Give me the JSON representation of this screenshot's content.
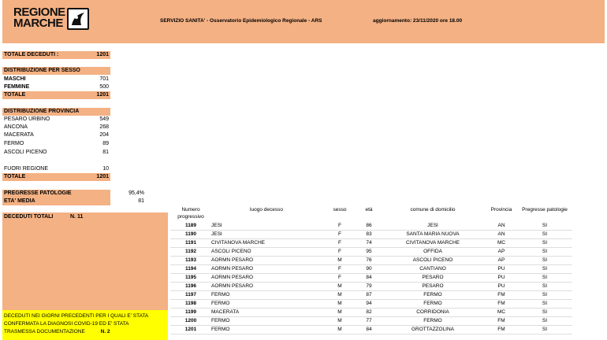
{
  "header": {
    "logo_line1": "REGIONE",
    "logo_line2": "MARCHE",
    "service": "SERVIZIO SANITA' - Osservatorio Epidemiologico Regionale - ARS",
    "update": "aggiornamento: 23/11/2020 ore 18.00"
  },
  "totale_deceduti": {
    "label": "TOTALE DECEDUTI :",
    "value": "1201"
  },
  "sesso": {
    "title": "DISTRIBUZIONE PER SESSO",
    "rows": [
      {
        "label": "MASCHI",
        "value": "701"
      },
      {
        "label": "FEMMINE",
        "value": "500"
      }
    ],
    "total_label": "TOTALE",
    "total_value": "1201"
  },
  "provincia": {
    "title": "DISTRIBUZIONE PROVINCIA",
    "rows": [
      {
        "label": "PESARO URBINO",
        "value": "549"
      },
      {
        "label": "ANCONA",
        "value": "268"
      },
      {
        "label": "MACERATA",
        "value": "204"
      },
      {
        "label": "FERMO",
        "value": "89"
      },
      {
        "label": "ASCOLI PICENO",
        "value": "81"
      }
    ],
    "fuori_label": "FUORI REGIONE",
    "fuori_value": "10",
    "total_label": "TOTALE",
    "total_value": "1201"
  },
  "patologie": {
    "label": "PREGRESSE PATOLOGIE",
    "value": "95,4%"
  },
  "eta": {
    "label": "ETA' MEDIA",
    "value": "81"
  },
  "deceduti_totali": {
    "label": "DECEDUTI TOTALI",
    "value": "N. 11"
  },
  "yellow_note": {
    "line1": "DECEDUTI NEI GIORNI PRECEDENTI PER I QUALI E' STATA",
    "line2": "CONFERMATA LA DIAGNOSI COVID-19 ED E' STATA",
    "line3": "TRASMESSA DOCUMENTAZIONE",
    "count": "N. 2"
  },
  "table": {
    "headers": {
      "num": "Numero progressivo",
      "luogo": "luogo decesso",
      "sesso": "sesso",
      "eta": "età",
      "comune": "comune di domicilio",
      "provincia": "Provincia",
      "patologie": "Pregresse patologie"
    },
    "rows": [
      {
        "num": "1189",
        "luogo": "JESI",
        "sesso": "F",
        "eta": "86",
        "comune": "JESI",
        "provincia": "AN",
        "patologie": "SI"
      },
      {
        "num": "1190",
        "luogo": "JESI",
        "sesso": "F",
        "eta": "83",
        "comune": "SANTA MARIA NUOVA",
        "provincia": "AN",
        "patologie": "SI"
      },
      {
        "num": "1191",
        "luogo": "CIVITANOVA MARCHE",
        "sesso": "F",
        "eta": "74",
        "comune": "CIVITANOVA MARCHE",
        "provincia": "MC",
        "patologie": "SI"
      },
      {
        "num": "1192",
        "luogo": "ASCOLI PICENO",
        "sesso": "F",
        "eta": "95",
        "comune": "OFFIDA",
        "provincia": "AP",
        "patologie": "SI"
      },
      {
        "num": "1193",
        "luogo": "AORMN PESARO",
        "sesso": "M",
        "eta": "76",
        "comune": "ASCOLI PICENO",
        "provincia": "AP",
        "patologie": "SI"
      },
      {
        "num": "1194",
        "luogo": "AORMN PESARO",
        "sesso": "F",
        "eta": "90",
        "comune": "CANTIANO",
        "provincia": "PU",
        "patologie": "SI"
      },
      {
        "num": "1195",
        "luogo": "AORMN PESARO",
        "sesso": "F",
        "eta": "84",
        "comune": "PESARO",
        "provincia": "PU",
        "patologie": "SI"
      },
      {
        "num": "1196",
        "luogo": "AORMN PESARO",
        "sesso": "M",
        "eta": "79",
        "comune": "PESARO",
        "provincia": "PU",
        "patologie": "SI"
      },
      {
        "num": "1197",
        "luogo": "FERMO",
        "sesso": "M",
        "eta": "87",
        "comune": "FERMO",
        "provincia": "FM",
        "patologie": "SI"
      },
      {
        "num": "1198",
        "luogo": "FERMO",
        "sesso": "M",
        "eta": "94",
        "comune": "FERMO",
        "provincia": "FM",
        "patologie": "SI"
      },
      {
        "num": "1199",
        "luogo": "MACERATA",
        "sesso": "M",
        "eta": "82",
        "comune": "CORRIDONIA",
        "provincia": "MC",
        "patologie": "SI"
      },
      {
        "num": "1200",
        "luogo": "FERMO",
        "sesso": "M",
        "eta": "77",
        "comune": "FERMO",
        "provincia": "FM",
        "patologie": "SI"
      },
      {
        "num": "1201",
        "luogo": "FERMO",
        "sesso": "M",
        "eta": "84",
        "comune": "GROTTAZZOLINA",
        "provincia": "FM",
        "patologie": "SI"
      }
    ]
  }
}
